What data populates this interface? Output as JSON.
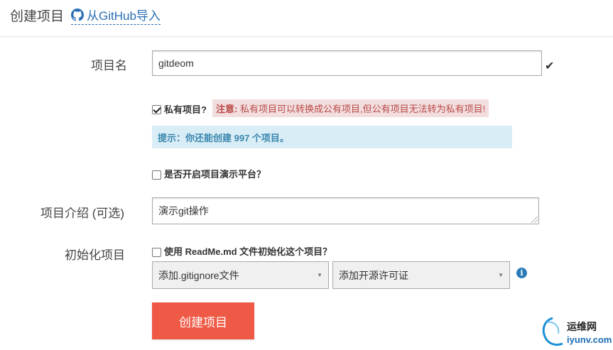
{
  "header": {
    "title": "创建项目",
    "github_link": "从GitHub导入"
  },
  "form": {
    "name": {
      "label": "项目名",
      "value": "gitdeom"
    },
    "private": {
      "checked": true,
      "label": "私有项目?",
      "warning_prefix": "注意:",
      "warning_text": "私有项目可以转换成公有项目,但公有项目无法转为私有项目!"
    },
    "tip": "提示：你还能创建 997 个项目。",
    "demo_platform": {
      "checked": false,
      "label": "是否开启项目演示平台？"
    },
    "description": {
      "label": "项目介绍 (可选)",
      "value": "演示git操作"
    },
    "init": {
      "label": "初始化项目",
      "readme_checked": false,
      "readme_label": "使用 ReadMe.md 文件初始化这个项目？",
      "gitignore_select": "添加.gitignore文件",
      "license_select": "添加开源许可证"
    },
    "submit_label": "创建项目"
  },
  "watermark": {
    "name": "运维网",
    "domain": "iyunv.com"
  },
  "colors": {
    "accent_button": "#ef5a46",
    "link": "#2a6fb5",
    "warning_bg": "#f2dede",
    "warning_text": "#b94a48",
    "info_bg": "#d9edf7",
    "info_text": "#3a87ad"
  },
  "icons": [
    "github-icon",
    "checkmark-icon",
    "info-icon",
    "caret-down-icon",
    "resize-grip-icon"
  ]
}
